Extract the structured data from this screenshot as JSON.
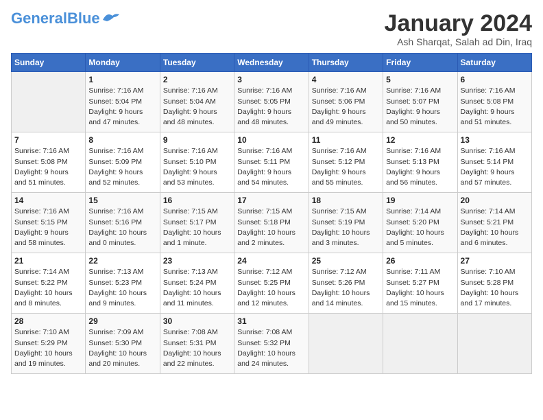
{
  "header": {
    "logo_general": "General",
    "logo_blue": "Blue",
    "month_title": "January 2024",
    "location": "Ash Sharqat, Salah ad Din, Iraq"
  },
  "weekdays": [
    "Sunday",
    "Monday",
    "Tuesday",
    "Wednesday",
    "Thursday",
    "Friday",
    "Saturday"
  ],
  "weeks": [
    [
      {
        "day": "",
        "info": ""
      },
      {
        "day": "1",
        "info": "Sunrise: 7:16 AM\nSunset: 5:04 PM\nDaylight: 9 hours\nand 47 minutes."
      },
      {
        "day": "2",
        "info": "Sunrise: 7:16 AM\nSunset: 5:04 AM\nDaylight: 9 hours\nand 48 minutes."
      },
      {
        "day": "3",
        "info": "Sunrise: 7:16 AM\nSunset: 5:05 PM\nDaylight: 9 hours\nand 48 minutes."
      },
      {
        "day": "4",
        "info": "Sunrise: 7:16 AM\nSunset: 5:06 PM\nDaylight: 9 hours\nand 49 minutes."
      },
      {
        "day": "5",
        "info": "Sunrise: 7:16 AM\nSunset: 5:07 PM\nDaylight: 9 hours\nand 50 minutes."
      },
      {
        "day": "6",
        "info": "Sunrise: 7:16 AM\nSunset: 5:08 PM\nDaylight: 9 hours\nand 51 minutes."
      }
    ],
    [
      {
        "day": "7",
        "info": "Sunrise: 7:16 AM\nSunset: 5:08 PM\nDaylight: 9 hours\nand 51 minutes."
      },
      {
        "day": "8",
        "info": "Sunrise: 7:16 AM\nSunset: 5:09 PM\nDaylight: 9 hours\nand 52 minutes."
      },
      {
        "day": "9",
        "info": "Sunrise: 7:16 AM\nSunset: 5:10 PM\nDaylight: 9 hours\nand 53 minutes."
      },
      {
        "day": "10",
        "info": "Sunrise: 7:16 AM\nSunset: 5:11 PM\nDaylight: 9 hours\nand 54 minutes."
      },
      {
        "day": "11",
        "info": "Sunrise: 7:16 AM\nSunset: 5:12 PM\nDaylight: 9 hours\nand 55 minutes."
      },
      {
        "day": "12",
        "info": "Sunrise: 7:16 AM\nSunset: 5:13 PM\nDaylight: 9 hours\nand 56 minutes."
      },
      {
        "day": "13",
        "info": "Sunrise: 7:16 AM\nSunset: 5:14 PM\nDaylight: 9 hours\nand 57 minutes."
      }
    ],
    [
      {
        "day": "14",
        "info": "Sunrise: 7:16 AM\nSunset: 5:15 PM\nDaylight: 9 hours\nand 58 minutes."
      },
      {
        "day": "15",
        "info": "Sunrise: 7:16 AM\nSunset: 5:16 PM\nDaylight: 10 hours\nand 0 minutes."
      },
      {
        "day": "16",
        "info": "Sunrise: 7:15 AM\nSunset: 5:17 PM\nDaylight: 10 hours\nand 1 minute."
      },
      {
        "day": "17",
        "info": "Sunrise: 7:15 AM\nSunset: 5:18 PM\nDaylight: 10 hours\nand 2 minutes."
      },
      {
        "day": "18",
        "info": "Sunrise: 7:15 AM\nSunset: 5:19 PM\nDaylight: 10 hours\nand 3 minutes."
      },
      {
        "day": "19",
        "info": "Sunrise: 7:14 AM\nSunset: 5:20 PM\nDaylight: 10 hours\nand 5 minutes."
      },
      {
        "day": "20",
        "info": "Sunrise: 7:14 AM\nSunset: 5:21 PM\nDaylight: 10 hours\nand 6 minutes."
      }
    ],
    [
      {
        "day": "21",
        "info": "Sunrise: 7:14 AM\nSunset: 5:22 PM\nDaylight: 10 hours\nand 8 minutes."
      },
      {
        "day": "22",
        "info": "Sunrise: 7:13 AM\nSunset: 5:23 PM\nDaylight: 10 hours\nand 9 minutes."
      },
      {
        "day": "23",
        "info": "Sunrise: 7:13 AM\nSunset: 5:24 PM\nDaylight: 10 hours\nand 11 minutes."
      },
      {
        "day": "24",
        "info": "Sunrise: 7:12 AM\nSunset: 5:25 PM\nDaylight: 10 hours\nand 12 minutes."
      },
      {
        "day": "25",
        "info": "Sunrise: 7:12 AM\nSunset: 5:26 PM\nDaylight: 10 hours\nand 14 minutes."
      },
      {
        "day": "26",
        "info": "Sunrise: 7:11 AM\nSunset: 5:27 PM\nDaylight: 10 hours\nand 15 minutes."
      },
      {
        "day": "27",
        "info": "Sunrise: 7:10 AM\nSunset: 5:28 PM\nDaylight: 10 hours\nand 17 minutes."
      }
    ],
    [
      {
        "day": "28",
        "info": "Sunrise: 7:10 AM\nSunset: 5:29 PM\nDaylight: 10 hours\nand 19 minutes."
      },
      {
        "day": "29",
        "info": "Sunrise: 7:09 AM\nSunset: 5:30 PM\nDaylight: 10 hours\nand 20 minutes."
      },
      {
        "day": "30",
        "info": "Sunrise: 7:08 AM\nSunset: 5:31 PM\nDaylight: 10 hours\nand 22 minutes."
      },
      {
        "day": "31",
        "info": "Sunrise: 7:08 AM\nSunset: 5:32 PM\nDaylight: 10 hours\nand 24 minutes."
      },
      {
        "day": "",
        "info": ""
      },
      {
        "day": "",
        "info": ""
      },
      {
        "day": "",
        "info": ""
      }
    ]
  ]
}
